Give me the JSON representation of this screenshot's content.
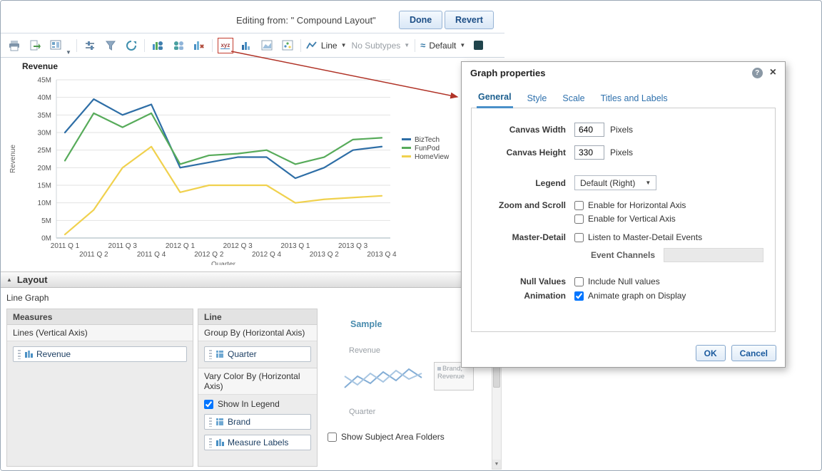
{
  "header": {
    "editing_from": "Editing from: \" Compound Layout\"",
    "done": "Done",
    "revert": "Revert"
  },
  "toolbar": {
    "line_label": "Line",
    "no_subtypes_label": "No Subtypes",
    "style_label": "Default",
    "xyz_label": "xyz",
    "icons": [
      "print",
      "export",
      "dashboard-preview",
      "export-menu-caret",
      "prompts",
      "filters",
      "refresh",
      "new-view",
      "duplicate-view",
      "delete-view",
      "graph-properties",
      "bar-graph",
      "area-graph",
      "scatter-graph",
      "line-type",
      "subtype-select",
      "style-select",
      "fill-color"
    ]
  },
  "chart_data": {
    "type": "line",
    "title": "Revenue",
    "xlabel": "Quarter",
    "ylabel": "Revenue",
    "categories": [
      "2011 Q 1",
      "2011 Q 2",
      "2011 Q 3",
      "2011 Q 4",
      "2012 Q 1",
      "2012 Q 2",
      "2012 Q 3",
      "2012 Q 4",
      "2013 Q 1",
      "2013 Q 2",
      "2013 Q 3",
      "2013 Q 4"
    ],
    "series": [
      {
        "name": "BizTech",
        "color": "#2e6ea6",
        "values": [
          30,
          39.5,
          35,
          38,
          20,
          21.5,
          23,
          23,
          17,
          20,
          25,
          26
        ]
      },
      {
        "name": "FunPod",
        "color": "#57ab5a",
        "values": [
          22,
          35.5,
          31.5,
          35.5,
          21,
          23.5,
          24,
          25,
          21,
          23,
          28,
          28.5
        ]
      },
      {
        "name": "HomeView",
        "color": "#f0d14e",
        "values": [
          1,
          8,
          20,
          26,
          13,
          15,
          15,
          15,
          10,
          11,
          11.5,
          12
        ]
      }
    ],
    "ylim": [
      0,
      45
    ],
    "ytick_step": 5,
    "ytick_suffix": "M",
    "legend_position": "right",
    "grid": true
  },
  "layout": {
    "title": "Layout",
    "graph_type": "Line Graph",
    "measures_title": "Measures",
    "lines_section": "Lines (Vertical Axis)",
    "measure_item": "Revenue",
    "line_title": "Line",
    "group_by": "Group By (Horizontal Axis)",
    "group_item": "Quarter",
    "vary_color": "Vary Color By (Horizontal Axis)",
    "show_in_legend": "Show In Legend",
    "show_in_legend_checked": true,
    "vary_item1": "Brand",
    "vary_item2": "Measure Labels",
    "sample_title": "Sample",
    "sample_y": "Revenue",
    "sample_x": "Quarter",
    "sample_legend": "Brand, Revenue",
    "show_subject": "Show Subject Area Folders",
    "show_subject_checked": false
  },
  "dialog": {
    "title": "Graph properties",
    "help_icon": "?",
    "close_icon": "×",
    "tabs": [
      "General",
      "Style",
      "Scale",
      "Titles and Labels"
    ],
    "canvas_width_label": "Canvas Width",
    "canvas_width": "640",
    "pixels": "Pixels",
    "canvas_height_label": "Canvas Height",
    "canvas_height": "330",
    "legend_label": "Legend",
    "legend_value": "Default (Right)",
    "zoom_label": "Zoom and Scroll",
    "zoom_h": "Enable for Horizontal Axis",
    "zoom_h_checked": false,
    "zoom_v": "Enable for Vertical Axis",
    "zoom_v_checked": false,
    "master_label": "Master-Detail",
    "master_cb": "Listen to Master-Detail Events",
    "master_checked": false,
    "event_channels_label": "Event Channels",
    "null_label": "Null Values",
    "null_cb": "Include Null values",
    "null_checked": false,
    "anim_label": "Animation",
    "anim_cb": "Animate graph on Display",
    "anim_checked": true,
    "ok": "OK",
    "cancel": "Cancel"
  }
}
